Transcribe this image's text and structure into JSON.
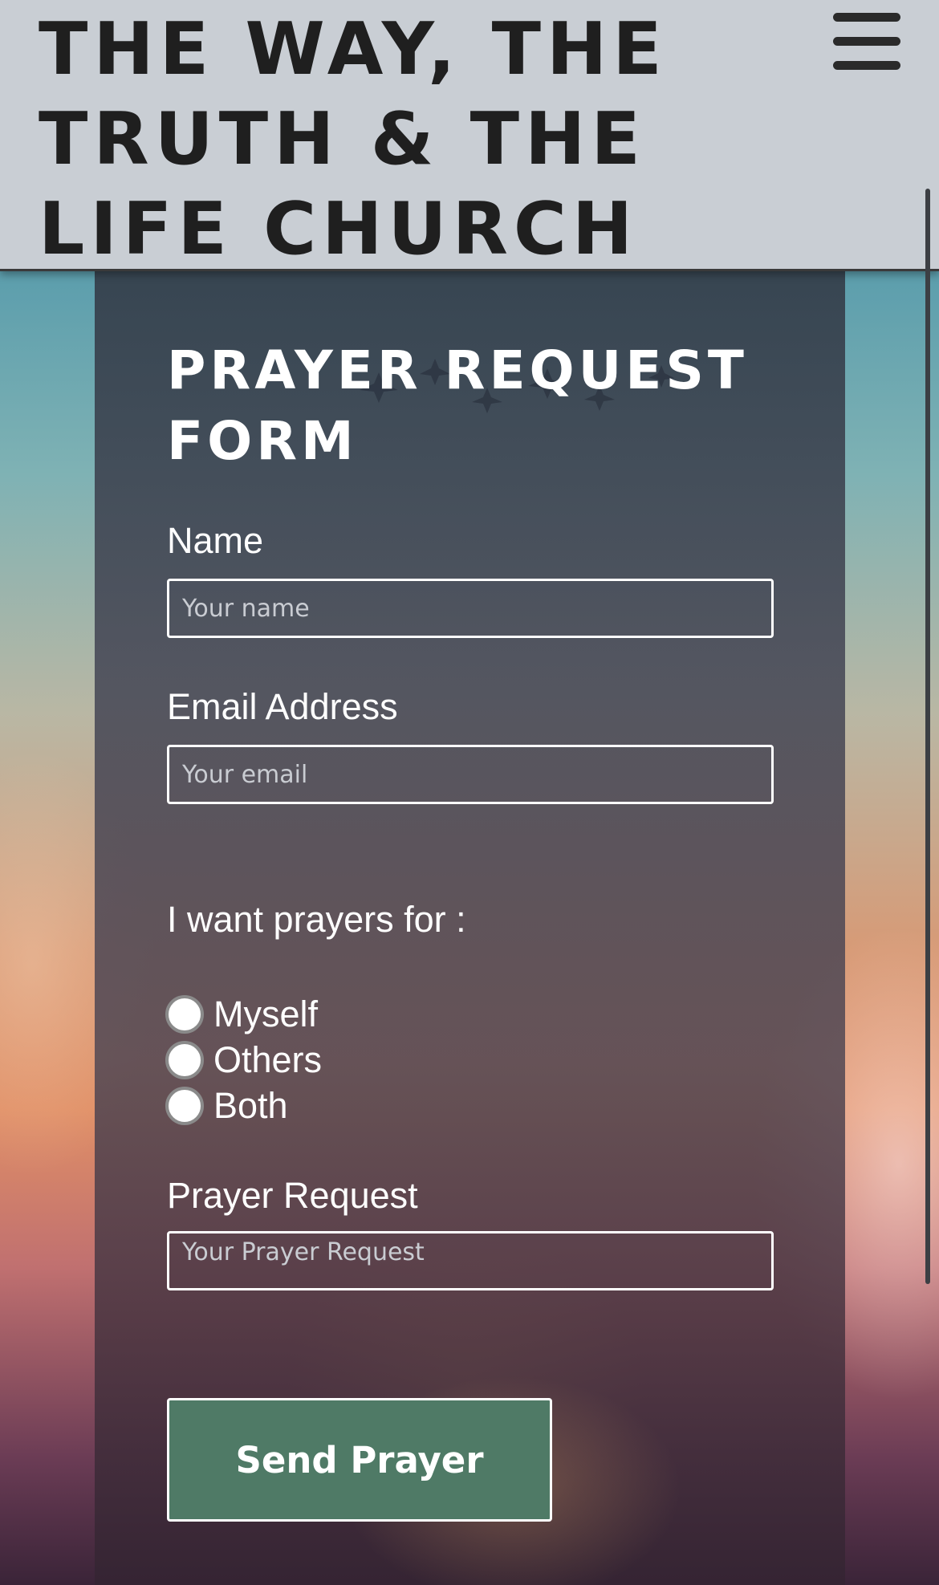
{
  "header": {
    "title": "THE WAY, THE TRUTH & THE LIFE CHURCH",
    "menu_icon": "hamburger-menu-icon"
  },
  "form": {
    "title": "PRAYER REQUEST FORM",
    "name": {
      "label": "Name",
      "placeholder": "Your name",
      "value": ""
    },
    "email": {
      "label": "Email Address",
      "placeholder": "Your email",
      "value": ""
    },
    "prayer_for": {
      "label": "I want prayers for :",
      "options": [
        "Myself",
        "Others",
        "Both"
      ],
      "selected": null
    },
    "request": {
      "label": "Prayer Request",
      "placeholder": "Your Prayer Request",
      "value": ""
    },
    "submit_label": "Send Prayer"
  },
  "colors": {
    "header_bg": "#c9ced4",
    "title_text": "#1f1f1f",
    "panel_text": "#ffffff",
    "button_bg": "#4f7a66"
  }
}
